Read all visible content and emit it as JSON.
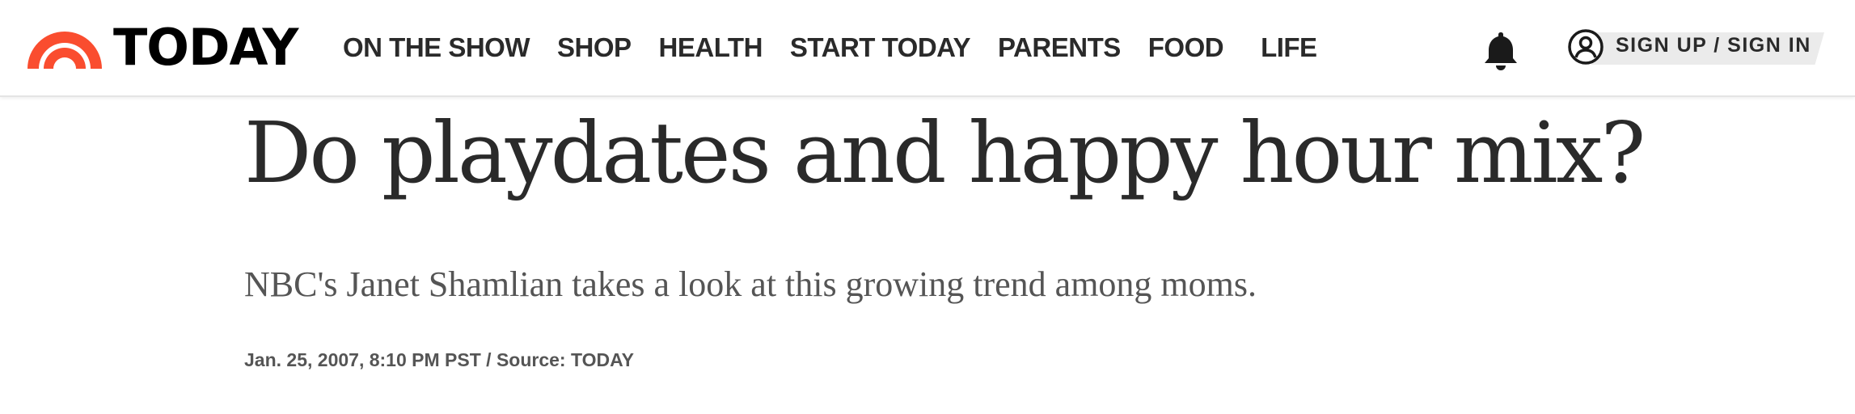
{
  "header": {
    "logo_text": "TODAY",
    "nav": [
      {
        "label": "ON THE SHOW"
      },
      {
        "label": "SHOP"
      },
      {
        "label": "HEALTH"
      },
      {
        "label": "START TODAY"
      },
      {
        "label": "PARENTS"
      },
      {
        "label": "FOOD"
      },
      {
        "label": "LIFE"
      }
    ],
    "notifications_icon": "bell-icon",
    "account_icon": "user-circle-icon",
    "signin_label": "SIGN UP / SIGN IN"
  },
  "article": {
    "headline": "Do playdates and happy hour mix?",
    "dek": "NBC's Janet Shamlian takes a look at this growing trend among moms.",
    "byline": "Jan. 25, 2007, 8:10 PM PST / Source: TODAY"
  },
  "colors": {
    "brand_orange": "#fa4d2f",
    "text_dark": "#2a2a2a",
    "text_muted": "#555555",
    "signin_bg": "#ebebeb"
  }
}
